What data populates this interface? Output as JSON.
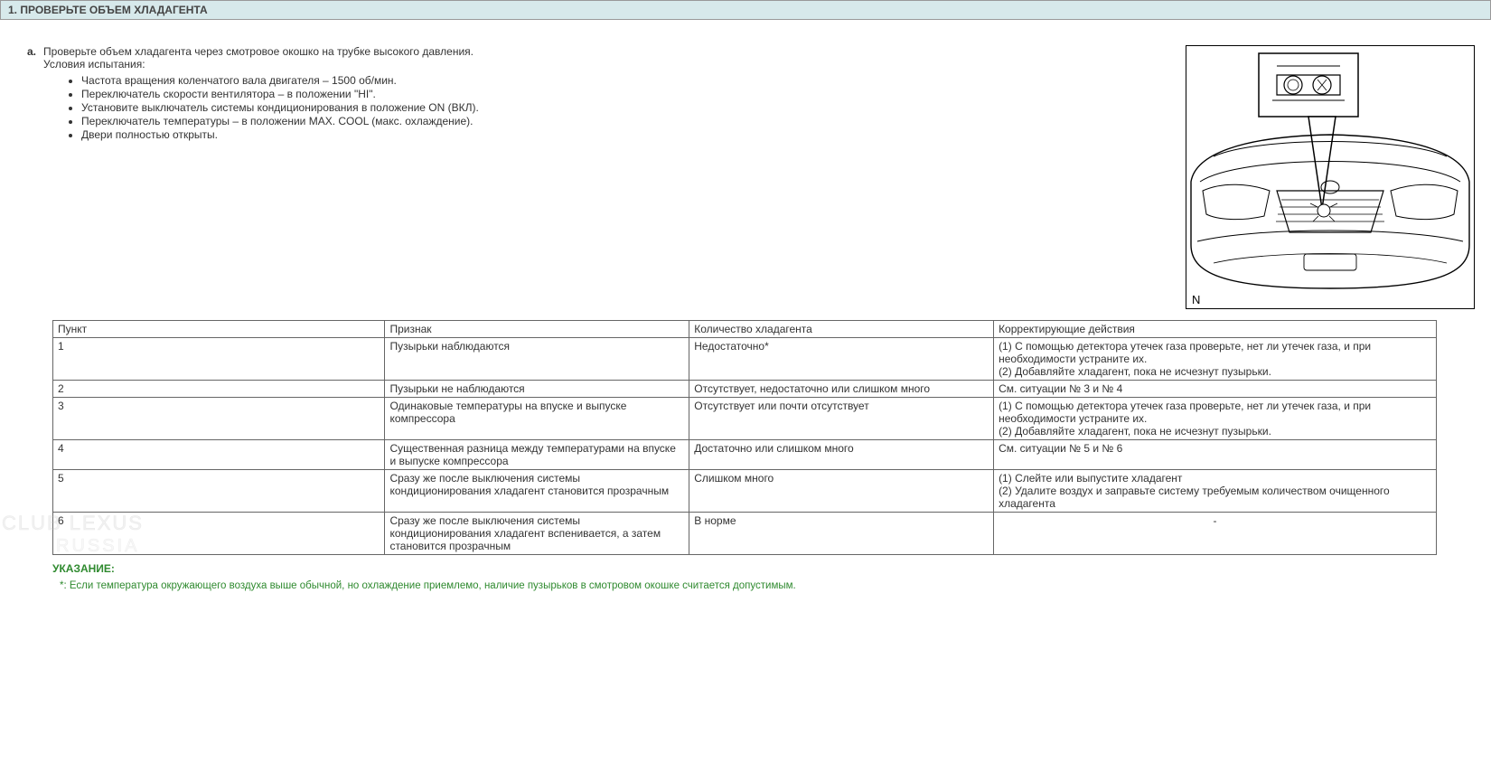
{
  "section": {
    "number": "1.",
    "title": "ПРОВЕРЬТЕ ОБЪЕМ ХЛАДАГЕНТА"
  },
  "step": {
    "letter": "a.",
    "instruction": "Проверьте объем хладагента через смотровое окошко на трубке высокого давления.",
    "conditions_label": "Условия испытания:",
    "conditions": [
      "Частота вращения коленчатого вала двигателя – 1500 об/мин.",
      "Переключатель скорости вентилятора – в положении \"HI\".",
      "Установите выключатель системы кондиционирования в положение ON (ВКЛ).",
      "Переключатель температуры – в положении MAX. COOL (макс. охлаждение).",
      "Двери полностью открыты."
    ]
  },
  "diagram": {
    "label": "N"
  },
  "table": {
    "headers": {
      "item": "Пункт",
      "sign": "Признак",
      "amount": "Количество хладагента",
      "action": "Корректирующие действия"
    },
    "rows": [
      {
        "item": "1",
        "sign": "Пузырьки наблюдаются",
        "amount": "Недостаточно*",
        "action": "(1) С помощью детектора утечек газа проверьте, нет ли утечек газа, и при необходимости устраните их.\n(2) Добавляйте хладагент, пока не исчезнут пузырьки."
      },
      {
        "item": "2",
        "sign": "Пузырьки не наблюдаются",
        "amount": "Отсутствует, недостаточно или слишком много",
        "action": "См. ситуации № 3 и № 4"
      },
      {
        "item": "3",
        "sign": "Одинаковые температуры на впуске и выпуске компрессора",
        "amount": "Отсутствует или почти отсутствует",
        "action": "(1) С помощью детектора утечек газа проверьте, нет ли утечек газа, и при необходимости устраните их.\n(2) Добавляйте хладагент, пока не исчезнут пузырьки."
      },
      {
        "item": "4",
        "sign": "Существенная разница между температурами на впуске и выпуске компрессора",
        "amount": "Достаточно или слишком много",
        "action": "См. ситуации № 5 и № 6"
      },
      {
        "item": "5",
        "sign": "Сразу же после выключения системы кондиционирования хладагент становится прозрачным",
        "amount": "Слишком много",
        "action": "(1) Слейте или выпустите хладагент\n(2) Удалите воздух и заправьте систему требуемым количеством очищенного хладагента"
      },
      {
        "item": "6",
        "sign": "Сразу же после выключения системы кондиционирования хладагент вспенивается, а затем становится прозрачным",
        "amount": "В норме",
        "action": "-",
        "action_center": true
      }
    ]
  },
  "hint": {
    "label": "УКАЗАНИЕ:",
    "text": "*: Если температура окружающего воздуха выше обычной, но охлаждение приемлемо, наличие пузырьков в смотровом окошке считается допустимым."
  },
  "watermark": {
    "line1": "CLUB LEXUS",
    "line2": "RUSSIA"
  }
}
